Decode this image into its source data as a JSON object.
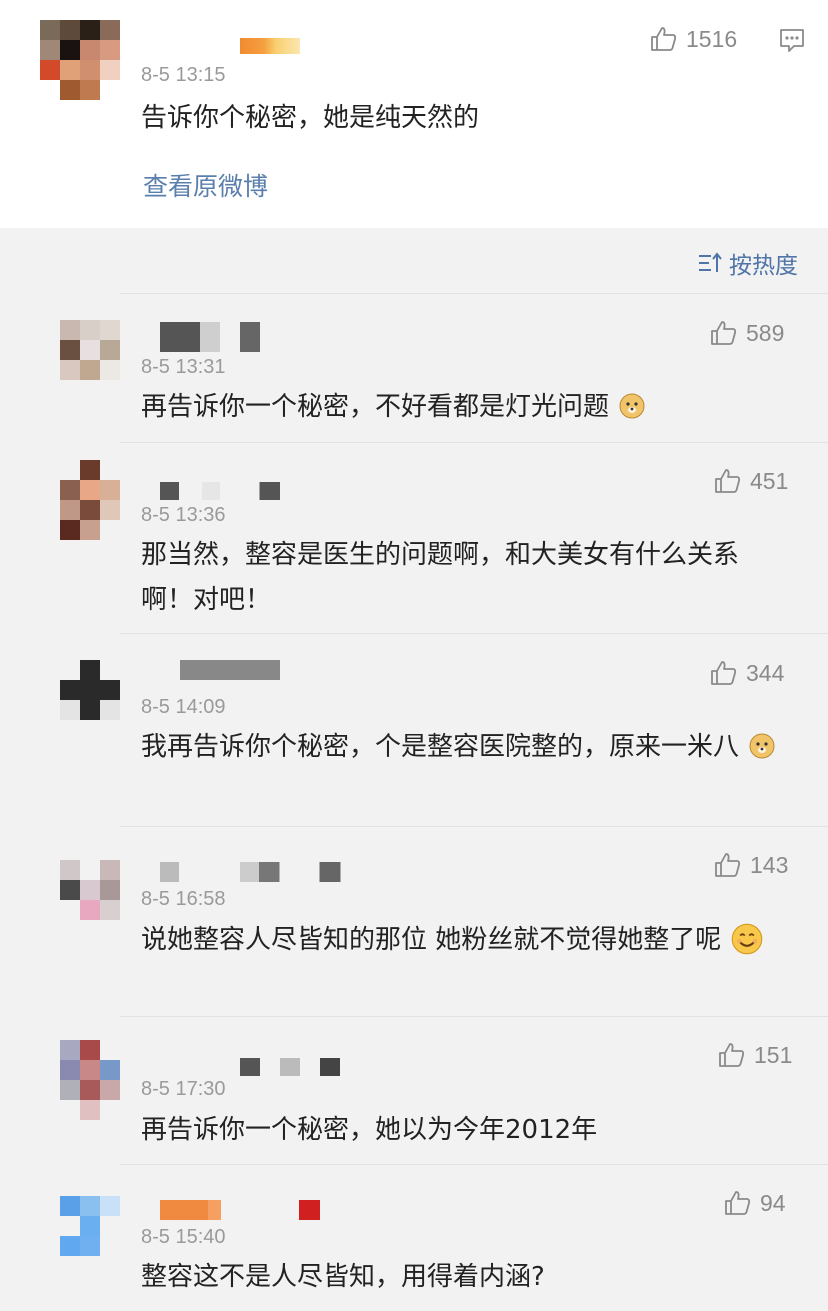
{
  "top_post": {
    "timestamp": "8-5 13:15",
    "text": "告诉你个秘密，她是纯天然的",
    "likes": "1516",
    "view_original": "查看原微博"
  },
  "sort_label": "按热度",
  "comments": [
    {
      "timestamp": "8-5 13:31",
      "text": "再告诉你一个秘密，不好看都是灯光问题",
      "likes": "589",
      "emoji": "doge"
    },
    {
      "timestamp": "8-5 13:36",
      "text": "那当然，整容是医生的问题啊，和大美女有什么关系啊！对吧！",
      "likes": "451"
    },
    {
      "timestamp": "8-5 14:09",
      "text": "我再告诉你个秘密，个是整容医院整的，原来一米八",
      "likes": "344",
      "emoji": "doge"
    },
    {
      "timestamp": "8-5 16:58",
      "text": "说她整容人尽皆知的那位 她粉丝就不觉得她整了呢",
      "likes": "143",
      "emoji": "smile"
    },
    {
      "timestamp": "8-5 17:30",
      "text": "再告诉你一个秘密，她以为今年2012年",
      "likes": "151"
    },
    {
      "timestamp": "8-5 15:40",
      "text": "整容这不是人尽皆知，用得着内涵?",
      "likes": "94"
    }
  ],
  "colors": {
    "link": "#5b7fad",
    "sort": "#4f74a8",
    "meta": "#9a9a9a"
  }
}
